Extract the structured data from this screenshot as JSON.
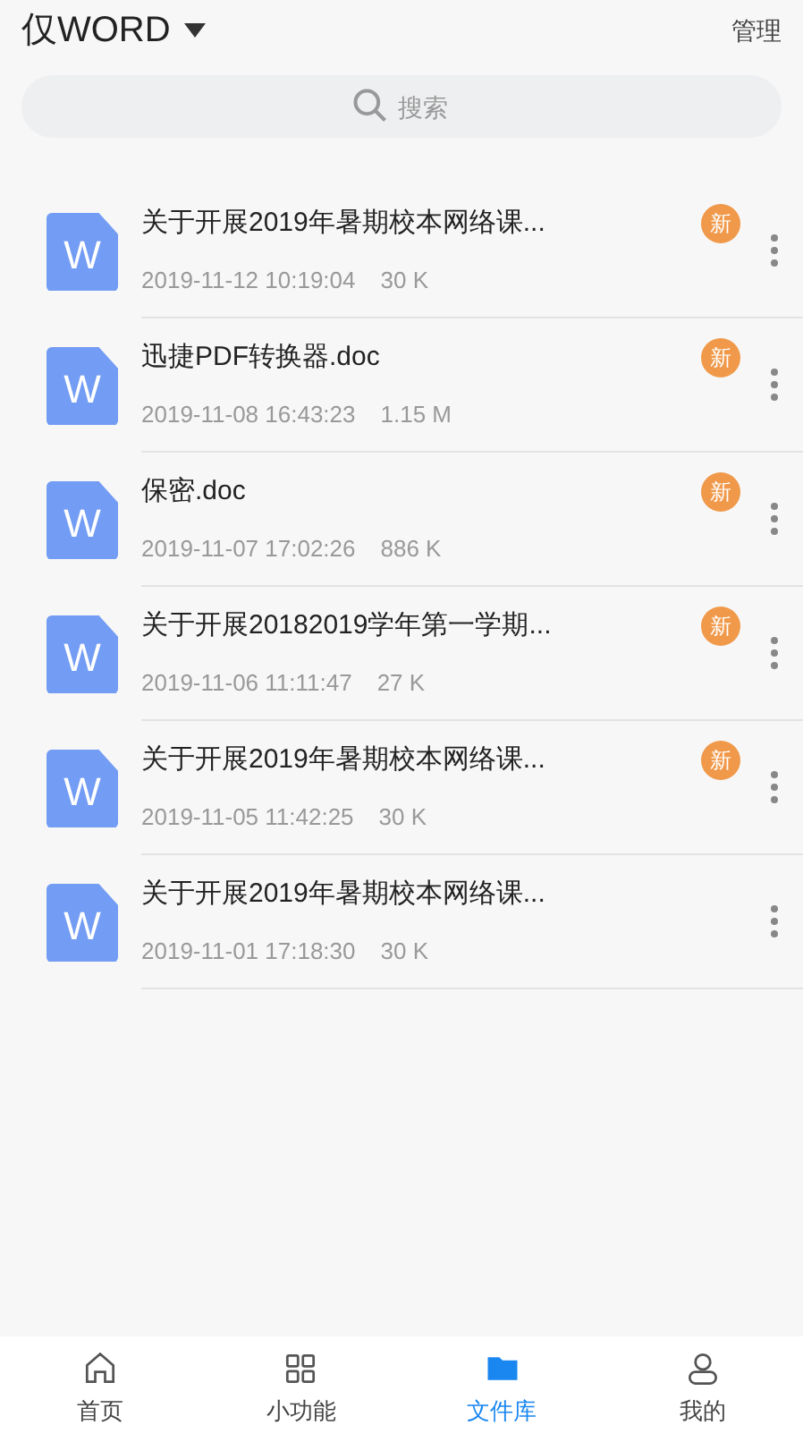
{
  "header": {
    "title": "仅WORD",
    "action": "管理"
  },
  "search": {
    "placeholder": "搜索"
  },
  "files": [
    {
      "icon_letter": "W",
      "name": "关于开展2019年暑期校本网络课...",
      "date": "2019-11-12 10:19:04",
      "size": "30 K",
      "badge": "新"
    },
    {
      "icon_letter": "W",
      "name": "迅捷PDF转换器.doc",
      "date": "2019-11-08 16:43:23",
      "size": "1.15 M",
      "badge": "新"
    },
    {
      "icon_letter": "W",
      "name": "保密.doc",
      "date": "2019-11-07 17:02:26",
      "size": "886 K",
      "badge": "新"
    },
    {
      "icon_letter": "W",
      "name": "关于开展20182019学年第一学期...",
      "date": "2019-11-06 11:11:47",
      "size": "27 K",
      "badge": "新"
    },
    {
      "icon_letter": "W",
      "name": "关于开展2019年暑期校本网络课...",
      "date": "2019-11-05 11:42:25",
      "size": "30 K",
      "badge": "新"
    },
    {
      "icon_letter": "W",
      "name": "关于开展2019年暑期校本网络课...",
      "date": "2019-11-01 17:18:30",
      "size": "30 K"
    }
  ],
  "tabs": [
    {
      "kind": "home",
      "label": "首页",
      "selected": false
    },
    {
      "kind": "grid",
      "label": "小功能",
      "selected": false
    },
    {
      "kind": "folder",
      "label": "文件库",
      "selected": true
    },
    {
      "kind": "person",
      "label": "我的",
      "selected": false
    }
  ]
}
